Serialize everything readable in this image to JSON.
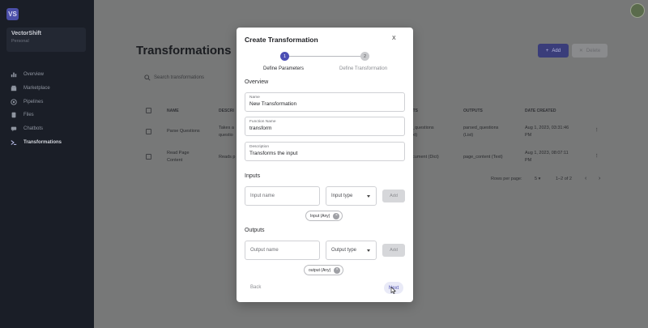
{
  "app": {
    "logo_text": "VS",
    "org_name": "VectorShift",
    "org_sub": "Personal"
  },
  "sidebar": {
    "items": [
      {
        "label": "Overview",
        "icon": "bar-chart-icon"
      },
      {
        "label": "Marketplace",
        "icon": "store-icon"
      },
      {
        "label": "Pipelines",
        "icon": "pipeline-icon"
      },
      {
        "label": "Files",
        "icon": "file-icon"
      },
      {
        "label": "Chatbots",
        "icon": "chat-icon"
      },
      {
        "label": "Transformations",
        "icon": "transform-icon",
        "active": true
      }
    ]
  },
  "page": {
    "title": "Transformations",
    "add_label": "Add",
    "delete_label": "Delete",
    "search_placeholder": "Search transformations"
  },
  "table": {
    "headers": [
      "NAME",
      "DESCRI",
      "UTS",
      "OUTPUTS",
      "DATE CREATED"
    ],
    "rows": [
      {
        "name": "Parse Questions",
        "desc": "Takes a",
        "desc2": "questio",
        "inputs": "e_questions",
        "inputs2": "ext)",
        "outputs": "parsed_questions",
        "outputs2": "(List)",
        "date": "Aug 1, 2023, 03:31:46",
        "date2": "PM"
      },
      {
        "name": "Read Page",
        "name2": "Content",
        "desc": "Reads p",
        "inputs": "ocument (Dict)",
        "outputs": "page_content (Text)",
        "date": "Aug 1, 2023, 08:07:11",
        "date2": "PM"
      }
    ],
    "rows_per_page_label": "Rows per page:",
    "rows_per_page": "5",
    "range": "1–2 of 2"
  },
  "modal": {
    "title": "Create Transformation",
    "close": "X",
    "steps": [
      {
        "num": "1",
        "label": "Define Parameters"
      },
      {
        "num": "2",
        "label": "Define Transformation"
      }
    ],
    "overview_heading": "Overview",
    "name_label": "Name",
    "name_value": "New Transformation",
    "function_label": "Function Name",
    "function_value": "transform",
    "description_label": "Description",
    "description_value": "Transforms the input",
    "inputs_heading": "Inputs",
    "input_name_placeholder": "Input name",
    "input_type_placeholder": "Input type",
    "input_add": "Add",
    "input_chip": "Input (Any)",
    "outputs_heading": "Outputs",
    "output_name_placeholder": "Output name",
    "output_type_placeholder": "Output type",
    "output_add": "Add",
    "output_chip": "output (Any)",
    "back_label": "Back",
    "next_label": "Next"
  },
  "colors": {
    "accent": "#4c4fb4",
    "sidebar_bg": "#1a1e27",
    "overlay_bg": "#777878"
  }
}
